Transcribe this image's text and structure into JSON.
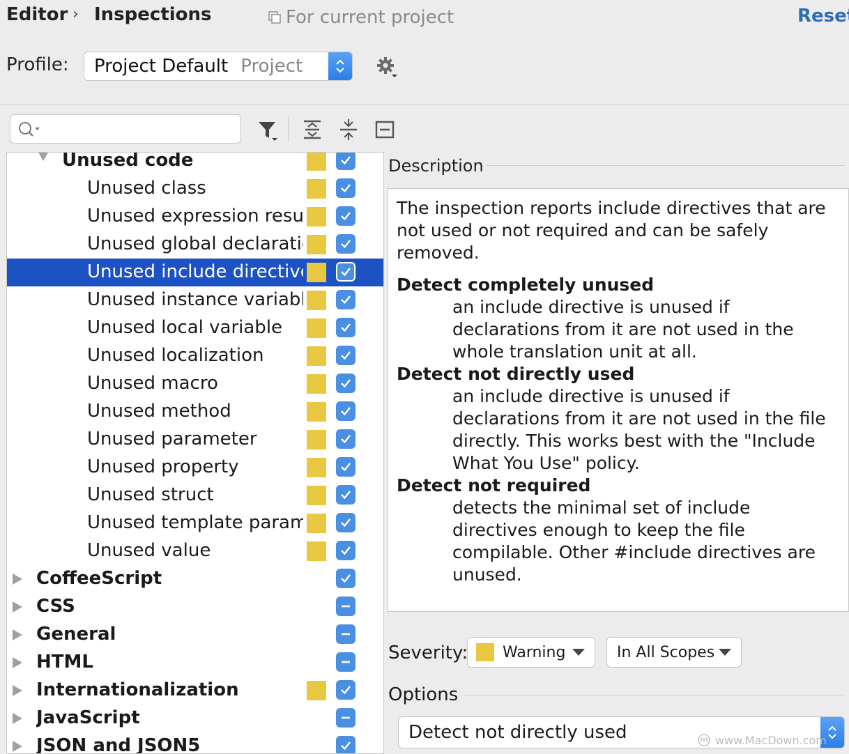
{
  "header": {
    "breadcrumb": [
      "Editor",
      "Inspections"
    ],
    "scope_note": "For current project",
    "reset_label": "Reset"
  },
  "profile": {
    "label": "Profile:",
    "name": "Project Default",
    "type": "Project"
  },
  "tree": {
    "rows": [
      {
        "label": "Unused code",
        "kind": "group",
        "expanded": true,
        "severity_swatch": true,
        "check": "checked"
      },
      {
        "label": "Unused class",
        "kind": "item",
        "severity_swatch": true,
        "check": "checked"
      },
      {
        "label": "Unused expression result",
        "kind": "item",
        "severity_swatch": true,
        "check": "checked"
      },
      {
        "label": "Unused global declaration",
        "kind": "item",
        "severity_swatch": true,
        "check": "checked"
      },
      {
        "label": "Unused include directive",
        "kind": "item",
        "severity_swatch": true,
        "check": "checked",
        "selected": true
      },
      {
        "label": "Unused instance variable",
        "kind": "item",
        "severity_swatch": true,
        "check": "checked"
      },
      {
        "label": "Unused local variable",
        "kind": "item",
        "severity_swatch": true,
        "check": "checked"
      },
      {
        "label": "Unused localization",
        "kind": "item",
        "severity_swatch": true,
        "check": "checked"
      },
      {
        "label": "Unused macro",
        "kind": "item",
        "severity_swatch": true,
        "check": "checked"
      },
      {
        "label": "Unused method",
        "kind": "item",
        "severity_swatch": true,
        "check": "checked"
      },
      {
        "label": "Unused parameter",
        "kind": "item",
        "severity_swatch": true,
        "check": "checked"
      },
      {
        "label": "Unused property",
        "kind": "item",
        "severity_swatch": true,
        "check": "checked"
      },
      {
        "label": "Unused struct",
        "kind": "item",
        "severity_swatch": true,
        "check": "checked"
      },
      {
        "label": "Unused template parameter",
        "kind": "item",
        "severity_swatch": true,
        "check": "checked"
      },
      {
        "label": "Unused value",
        "kind": "item",
        "severity_swatch": true,
        "check": "checked"
      },
      {
        "label": "CoffeeScript",
        "kind": "category",
        "severity_swatch": false,
        "check": "checked"
      },
      {
        "label": "CSS",
        "kind": "category",
        "severity_swatch": false,
        "check": "mixed"
      },
      {
        "label": "General",
        "kind": "category",
        "severity_swatch": false,
        "check": "mixed"
      },
      {
        "label": "HTML",
        "kind": "category",
        "severity_swatch": false,
        "check": "mixed"
      },
      {
        "label": "Internationalization",
        "kind": "category",
        "severity_swatch": true,
        "check": "checked"
      },
      {
        "label": "JavaScript",
        "kind": "category",
        "severity_swatch": false,
        "check": "mixed"
      },
      {
        "label": "JSON and JSON5",
        "kind": "category",
        "severity_swatch": false,
        "check": "checked"
      }
    ]
  },
  "description": {
    "title": "Description",
    "intro": "The inspection reports include directives that are not used or not required and can be safely removed.",
    "options": [
      {
        "term": "Detect completely unused",
        "text": "an include directive is unused if declarations from it are not used in the whole translation unit at all."
      },
      {
        "term": "Detect not directly used",
        "text": "an include directive is unused if declarations from it are not used in the file directly. This works best with the \"Include What You Use\" policy."
      },
      {
        "term": "Detect not required",
        "text": "detects the minimal set of include directives enough to keep the file compilable. Other #include directives are unused."
      }
    ]
  },
  "severity": {
    "label": "Severity:",
    "value": "Warning",
    "scope": "In All Scopes"
  },
  "options_section": {
    "label": "Options",
    "value": "Detect not directly used"
  },
  "watermark": "www.MacDown.com",
  "colors": {
    "accent": "#4a90e2",
    "selection": "#1d52c5",
    "warning": "#e8c840",
    "link": "#2f6db5"
  }
}
